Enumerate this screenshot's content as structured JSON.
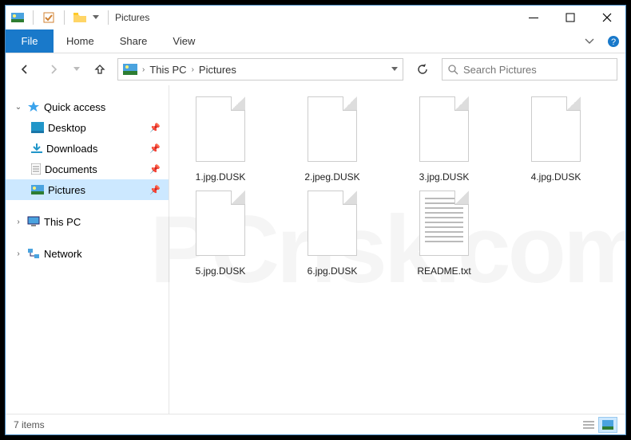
{
  "title": "Pictures",
  "ribbon": {
    "file": "File",
    "tabs": [
      "Home",
      "Share",
      "View"
    ]
  },
  "breadcrumb": [
    "This PC",
    "Pictures"
  ],
  "search_placeholder": "Search Pictures",
  "sidebar": {
    "quick_access": "Quick access",
    "items": [
      {
        "label": "Desktop",
        "pinned": true
      },
      {
        "label": "Downloads",
        "pinned": true
      },
      {
        "label": "Documents",
        "pinned": true
      },
      {
        "label": "Pictures",
        "pinned": true,
        "active": true
      }
    ],
    "this_pc": "This PC",
    "network": "Network"
  },
  "files": [
    {
      "name": "1.jpg.DUSK",
      "type": "generic"
    },
    {
      "name": "2.jpeg.DUSK",
      "type": "generic"
    },
    {
      "name": "3.jpg.DUSK",
      "type": "generic"
    },
    {
      "name": "4.jpg.DUSK",
      "type": "generic"
    },
    {
      "name": "5.jpg.DUSK",
      "type": "generic"
    },
    {
      "name": "6.jpg.DUSK",
      "type": "generic"
    },
    {
      "name": "README.txt",
      "type": "txt"
    }
  ],
  "status": {
    "item_count": "7 items"
  },
  "colors": {
    "accent": "#1979ca",
    "selection": "#cce8ff"
  }
}
